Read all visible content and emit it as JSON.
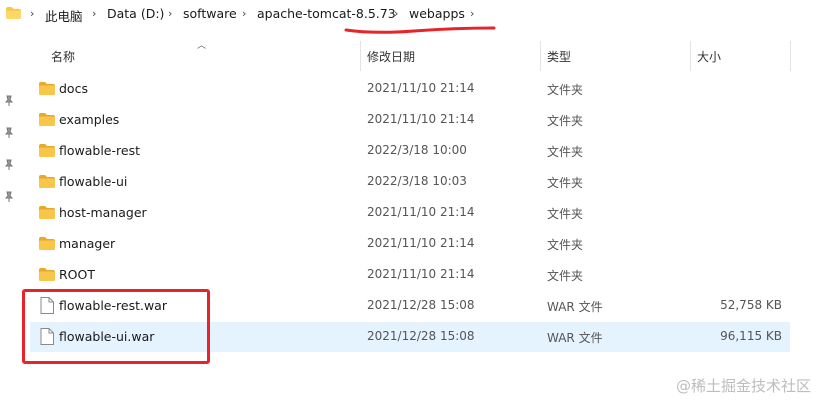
{
  "address_bar": {
    "crumbs": [
      "此电脑",
      "Data (D:)",
      "software",
      "apache-tomcat-8.5.73",
      "webapps"
    ]
  },
  "columns": {
    "name": "名称",
    "modified": "修改日期",
    "type": "类型",
    "size": "大小"
  },
  "files": [
    {
      "name": "docs",
      "modified": "2021/11/10 21:14",
      "type": "文件夹",
      "size": "",
      "kind": "folder"
    },
    {
      "name": "examples",
      "modified": "2021/11/10 21:14",
      "type": "文件夹",
      "size": "",
      "kind": "folder"
    },
    {
      "name": "flowable-rest",
      "modified": "2022/3/18 10:00",
      "type": "文件夹",
      "size": "",
      "kind": "folder"
    },
    {
      "name": "flowable-ui",
      "modified": "2022/3/18 10:03",
      "type": "文件夹",
      "size": "",
      "kind": "folder"
    },
    {
      "name": "host-manager",
      "modified": "2021/11/10 21:14",
      "type": "文件夹",
      "size": "",
      "kind": "folder"
    },
    {
      "name": "manager",
      "modified": "2021/11/10 21:14",
      "type": "文件夹",
      "size": "",
      "kind": "folder"
    },
    {
      "name": "ROOT",
      "modified": "2021/11/10 21:14",
      "type": "文件夹",
      "size": "",
      "kind": "folder"
    },
    {
      "name": "flowable-rest.war",
      "modified": "2021/12/28 15:08",
      "type": "WAR 文件",
      "size": "52,758 KB",
      "kind": "file"
    },
    {
      "name": "flowable-ui.war",
      "modified": "2021/12/28 15:08",
      "type": "WAR 文件",
      "size": "96,115 KB",
      "kind": "file"
    }
  ],
  "selected_row": 8,
  "watermark": "@稀土掘金技术社区",
  "colors": {
    "folder": "#f8c74a",
    "selected_row": "#cde8ff",
    "annotation_red": "#e8232a"
  }
}
